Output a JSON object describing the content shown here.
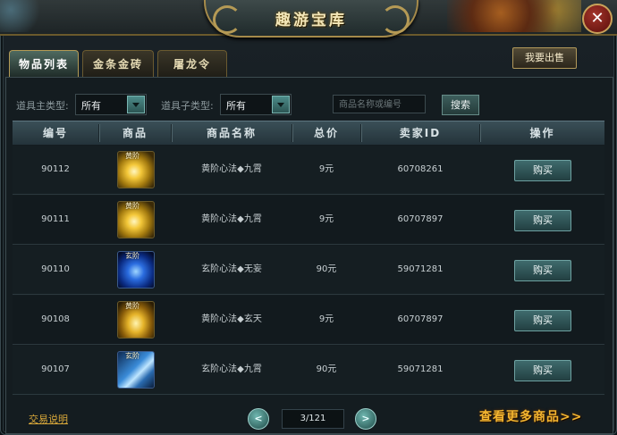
{
  "window": {
    "title": "趣游宝库"
  },
  "tabs": [
    {
      "label": "物品列表",
      "active": true
    },
    {
      "label": "金条金砖",
      "active": false
    },
    {
      "label": "屠龙令",
      "active": false
    }
  ],
  "sell_button": "我要出售",
  "filters": {
    "main_type_label": "道具主类型:",
    "main_type_value": "所有",
    "sub_type_label": "道具子类型:",
    "sub_type_value": "所有",
    "search_placeholder": "商品名称或编号",
    "search_button": "搜索"
  },
  "table": {
    "columns": [
      "编号",
      "商品",
      "商品名称",
      "总价",
      "卖家ID",
      "操作"
    ],
    "rows": [
      {
        "id": "90112",
        "icon": "gold-skill-icon",
        "icon_tag": "黄阶",
        "name": "黄阶心法◆九霄",
        "price": "9元",
        "seller": "60708261",
        "action": "购买"
      },
      {
        "id": "90111",
        "icon": "gold-skill-icon",
        "icon_tag": "黄阶",
        "name": "黄阶心法◆九霄",
        "price": "9元",
        "seller": "60707897",
        "action": "购买"
      },
      {
        "id": "90110",
        "icon": "blue-skill-icon",
        "icon_tag": "玄阶",
        "name": "玄阶心法◆无妄",
        "price": "90元",
        "seller": "59071281",
        "action": "购买"
      },
      {
        "id": "90108",
        "icon": "gold-skill-icon",
        "icon_tag": "黄阶",
        "name": "黄阶心法◆玄天",
        "price": "9元",
        "seller": "60707897",
        "action": "购买"
      },
      {
        "id": "90107",
        "icon": "blue-skill-icon",
        "icon_tag": "玄阶",
        "name": "玄阶心法◆九霄",
        "price": "90元",
        "seller": "59071281",
        "action": "购买"
      }
    ]
  },
  "footer": {
    "trade_help": "交易说明",
    "page_indicator": "3/121",
    "more_items": "查看更多商品>>"
  },
  "colors": {
    "accent_gold": "#f3b530",
    "button_teal": "#3f6b6d"
  }
}
